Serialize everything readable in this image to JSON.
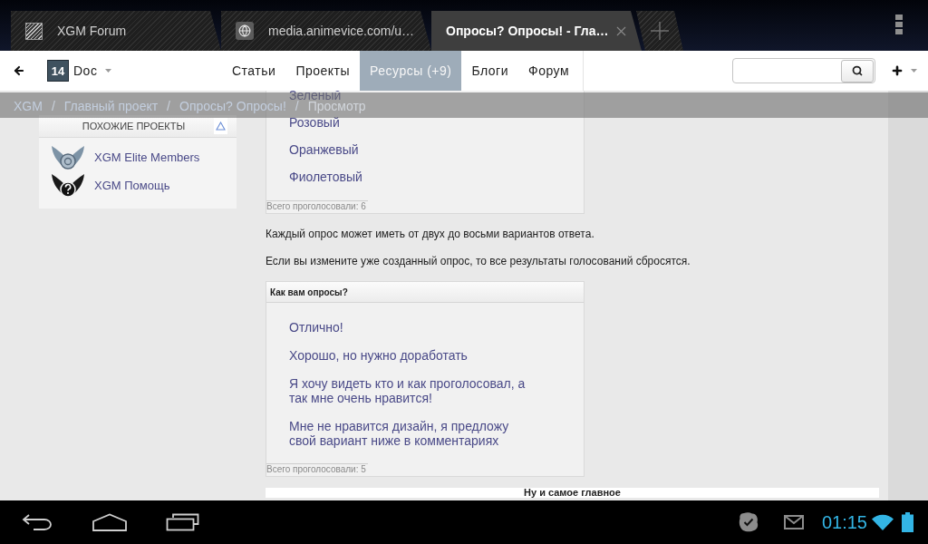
{
  "browser": {
    "tabs": [
      {
        "title": "XGM Forum",
        "kind": "site",
        "selected": false
      },
      {
        "title": "media.animevice.com/u…",
        "kind": "globe",
        "selected": false
      },
      {
        "title": "Опросы? Опросы! - Гла…",
        "kind": "page",
        "selected": true
      }
    ]
  },
  "site_nav": {
    "user_badge": "14",
    "user_name": "Doc",
    "menu": [
      {
        "label": "Статьи",
        "selected": false
      },
      {
        "label": "Проекты",
        "selected": false
      },
      {
        "label": "Ресурсы (+9)",
        "selected": true
      },
      {
        "label": "Блоги",
        "selected": false
      },
      {
        "label": "Форум",
        "selected": false
      }
    ]
  },
  "breadcrumb": {
    "separator": "/",
    "items": [
      "XGM",
      "Главный проект",
      "Опросы? Опросы!",
      "Просмотр"
    ]
  },
  "sidebar": {
    "title": "ПОХОЖИЕ ПРОЕКТЫ",
    "expanded": true,
    "items": [
      {
        "name": "XGM Elite Members",
        "kind": "elite"
      },
      {
        "name": "XGM Помощь",
        "kind": "help"
      }
    ]
  },
  "content": [
    {
      "kind": "poll",
      "options": [
        "Зеленый",
        "Розовый",
        "Оранжевый",
        "Фиолетовый"
      ],
      "total": "Всего проголосовали: 6"
    },
    {
      "kind": "paragraph",
      "text": "Каждый опрос может иметь от двух до восьми вариантов ответа."
    },
    {
      "kind": "paragraph",
      "text": "Если вы измените уже созданный опрос, то все результаты голосований сбросятся."
    },
    {
      "kind": "poll",
      "title": "Как вам опросы?",
      "options": [
        "Отлично!",
        "Хорошо, но нужно доработать",
        "Я хочу видеть кто и как проголосовал, а так мне очень нравится!",
        "Мне не нравится дизайн, я предложу свой вариант ниже в комментариях"
      ],
      "total": "Всего проголосовали: 5"
    },
    {
      "kind": "heading",
      "text": "Ну и самое главное"
    }
  ],
  "status_bar": {
    "time": "01:15"
  }
}
